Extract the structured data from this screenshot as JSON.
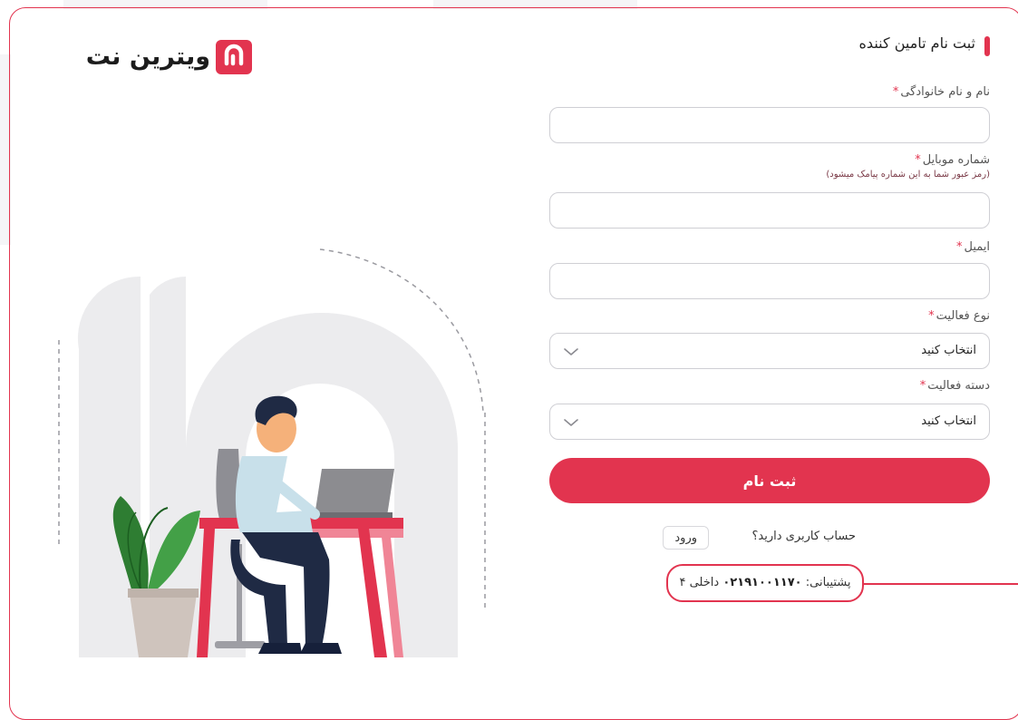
{
  "brand": {
    "logo_text": "ویترین نت"
  },
  "form": {
    "title": "ثبت نام تامین کننده",
    "fields": [
      {
        "label": "نام و نام خانوادگی",
        "required_mark": "*",
        "value": ""
      },
      {
        "label": "شماره موبایل",
        "required_mark": "*",
        "note": "(رمز عبور شما به این شماره پیامک میشود)",
        "value": ""
      },
      {
        "label": "ایمیل",
        "required_mark": "*",
        "value": ""
      }
    ],
    "selects": [
      {
        "label": "نوع فعالیت",
        "required_mark": "*",
        "value": "انتخاب کنید"
      },
      {
        "label": "دسته فعالیت",
        "required_mark": "*",
        "value": "انتخاب کنید"
      }
    ],
    "submit_label": "ثبت نام",
    "account_question": "حساب کاربری دارید؟",
    "login_label": "ورود",
    "support": {
      "label": "پشتیبانی:",
      "phone": "۰۲۱۹۱۰۰۱۱۷۰",
      "ext": "داخلی ۴"
    }
  },
  "colors": {
    "accent": "#e2344f",
    "border": "#cfcfd4"
  }
}
